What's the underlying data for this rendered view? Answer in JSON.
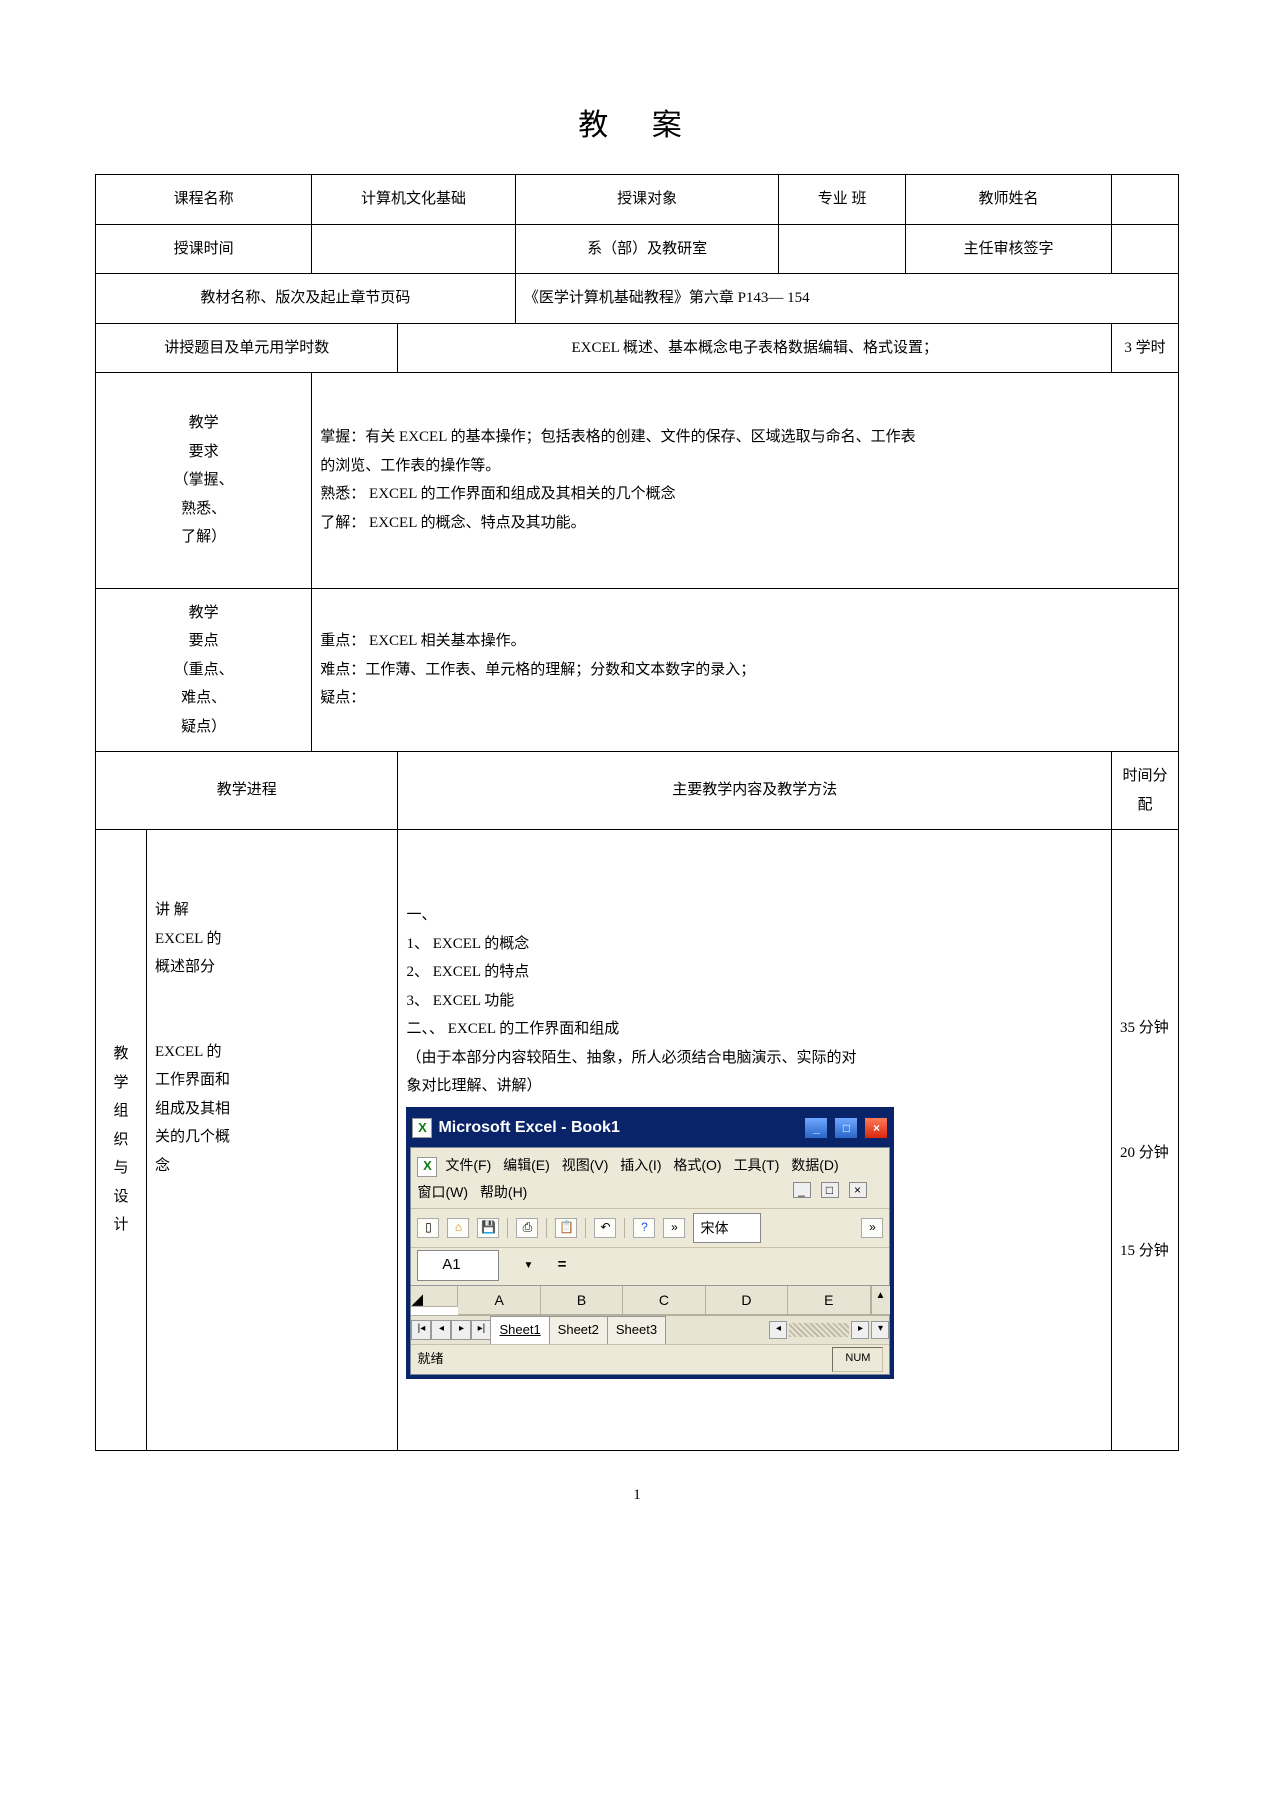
{
  "title": "教 案",
  "header": {
    "r1": {
      "c1": "课程名称",
      "c2": "计算机文化基础",
      "c3": "授课对象",
      "c4": "专业    班",
      "c5": "教师姓名",
      "c6": ""
    },
    "r2": {
      "c1": "授课时间",
      "c2": "",
      "c3": "系（部）及教研室",
      "c4": "",
      "c5": "主任审核签字",
      "c6": ""
    },
    "r3": {
      "c1": "教材名称、版次及起止章节页码",
      "c2": "《医学计算机基础教程》第六章    P143— 154"
    },
    "r4": {
      "c1": "讲授题目及单元用学时数",
      "c2": "EXCEL 概述、基本概念电子表格数据编辑、格式设置；",
      "c3": "3 学时"
    }
  },
  "req": {
    "label": "教学\n要求\n（掌握、\n熟悉、\n了解）",
    "l1": "掌握：有关  EXCEL 的基本操作；包括表格的创建、文件的保存、区域选取与命名、工作表",
    "l2": "的浏览、工作表的操作等。",
    "l3": "熟悉： EXCEL 的工作界面和组成及其相关的几个概念",
    "l4": "了解： EXCEL 的概念、特点及其功能。"
  },
  "pts": {
    "label": "教学\n要点\n（重点、\n难点、\n疑点）",
    "l1": "重点： EXCEL 相关基本操作。",
    "l2": "难点：工作薄、工作表、单元格的理解；分数和文本数字的录入；",
    "l3": "疑点："
  },
  "prog": {
    "h1": "教学进程",
    "h2": "主要教学内容及教学方法",
    "h3": "时间分配"
  },
  "org": {
    "side": "教\n学\n组\n织\n与\n设\n计",
    "p1a": "讲        解",
    "p1b": "EXCEL    的",
    "p1c": "概述部分",
    "p2a": "EXCEL    的",
    "p2b": "工作界面和",
    "p2c": "组成及其相",
    "p2d": "关的几个概",
    "p2e": "念",
    "content": {
      "b0": "一、",
      "b1": "1、 EXCEL 的概念",
      "b2": "2、 EXCEL 的特点",
      "b3": "3、 EXCEL 功能",
      "b4": "二、、 EXCEL 的工作界面和组成",
      "b5": "（由于本部分内容较陌生、抽象，所人必须结合电脑演示、实际的对",
      "b6": "象对比理解、讲解）"
    },
    "t1": "35 分钟",
    "t2": "20 分钟",
    "t3": "15 分钟"
  },
  "excel": {
    "title": "Microsoft Excel - Book1",
    "menu": [
      "文件(F)",
      "编辑(E)",
      "视图(V)",
      "插入(I)",
      "格式(O)",
      "工具(T)",
      "数据(D)",
      "窗口(W)",
      "帮助(H)"
    ],
    "font": "宋体",
    "nameBox": "A1",
    "cols": [
      "A",
      "B",
      "C",
      "D",
      "E"
    ],
    "tabs": [
      "Sheet1",
      "Sheet2",
      "Sheet3"
    ],
    "status": "就绪",
    "statusR": "NUM"
  },
  "page": "1"
}
